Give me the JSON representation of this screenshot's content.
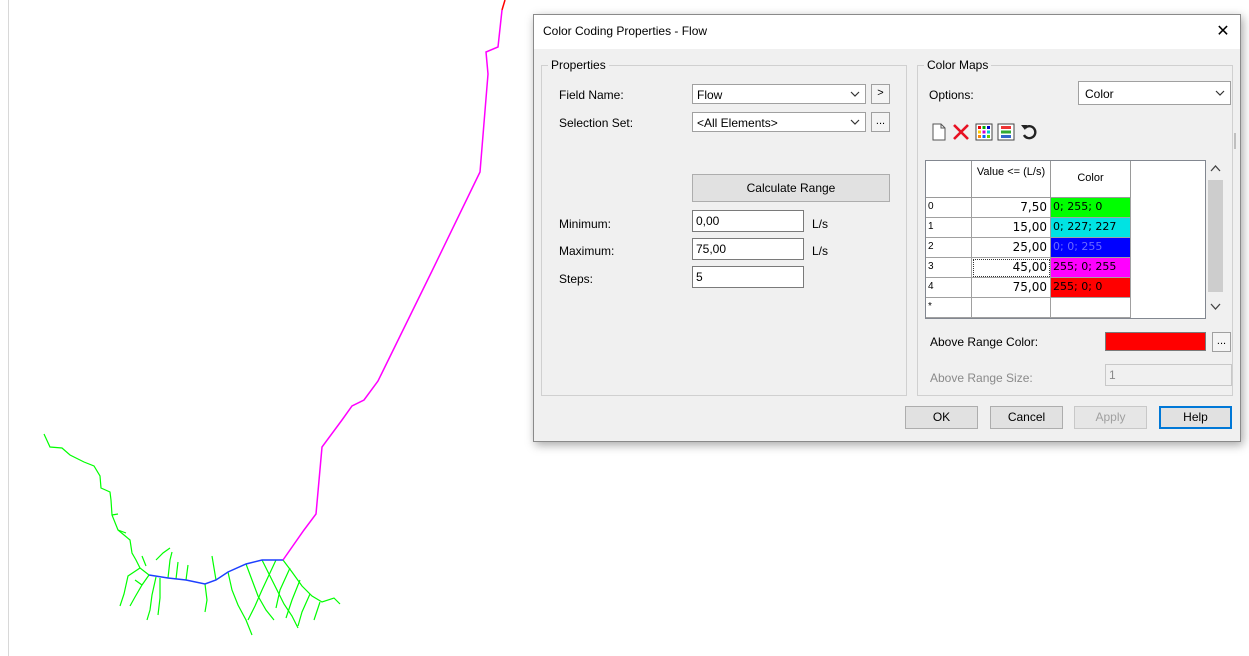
{
  "dialog": {
    "title": "Color Coding Properties - Flow",
    "close_label": "✕",
    "properties": {
      "legend": "Properties",
      "field_name_label": "Field Name:",
      "field_name_value": "Flow",
      "field_name_btn": ">",
      "selection_set_label": "Selection Set:",
      "selection_set_value": "<All Elements>",
      "selection_set_btn": "...",
      "calculate_label": "Calculate Range",
      "minimum_label": "Minimum:",
      "minimum_value": "0,00",
      "minimum_unit": "L/s",
      "maximum_label": "Maximum:",
      "maximum_value": "75,00",
      "maximum_unit": "L/s",
      "steps_label": "Steps:",
      "steps_value": "5"
    },
    "color_maps": {
      "legend": "Color Maps",
      "options_label": "Options:",
      "options_value": "Color",
      "toolbar_icons": [
        "new-icon",
        "delete-icon",
        "color-grid-icon",
        "ramp-icon",
        "reset-icon"
      ],
      "grid": {
        "value_header": "Value <= (L/s)",
        "color_header": "Color",
        "new_row_marker": "*",
        "rows": [
          {
            "index": "0",
            "value": "7,50",
            "color_text": "0; 255; 0",
            "color": "#00ff00",
            "text_color": "#000000"
          },
          {
            "index": "1",
            "value": "15,00",
            "color_text": "0; 227; 227",
            "color": "#00e3e3",
            "text_color": "#000000"
          },
          {
            "index": "2",
            "value": "25,00",
            "color_text": "0; 0; 255",
            "color": "#0000ff",
            "text_color": "#6a6aff"
          },
          {
            "index": "3",
            "value": "45,00",
            "color_text": "255; 0; 255",
            "color": "#ff00ff",
            "text_color": "#000000"
          },
          {
            "index": "4",
            "value": "75,00",
            "color_text": "255; 0; 0",
            "color": "#ff0000",
            "text_color": "#000000"
          }
        ]
      },
      "above_range_color_label": "Above Range Color:",
      "above_range_color": "#ff0000",
      "above_range_btn": "...",
      "above_range_size_label": "Above Range Size:",
      "above_range_size_value": "1"
    },
    "buttons": {
      "ok": "OK",
      "cancel": "Cancel",
      "apply": "Apply",
      "help": "Help"
    }
  },
  "network_colors": {
    "low": "#00ff00",
    "mid": "#0000ff",
    "high": "#ff00ff",
    "max": "#ff0000"
  }
}
